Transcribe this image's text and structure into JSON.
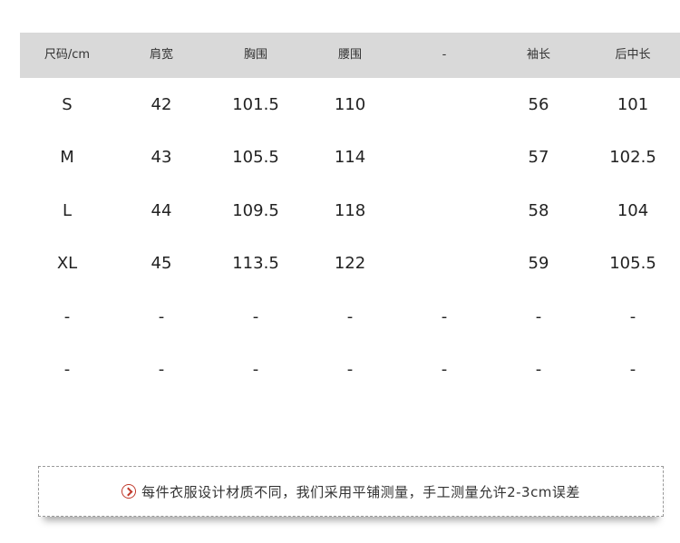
{
  "table": {
    "headers": [
      "尺码/cm",
      "肩宽",
      "胸围",
      "腰围",
      "-",
      "袖长",
      "后中长"
    ],
    "rows": [
      [
        "S",
        "42",
        "101.5",
        "110",
        "",
        "56",
        "101"
      ],
      [
        "M",
        "43",
        "105.5",
        "114",
        "",
        "57",
        "102.5"
      ],
      [
        "L",
        "44",
        "109.5",
        "118",
        "",
        "58",
        "104"
      ],
      [
        "XL",
        "45",
        "113.5",
        "122",
        "",
        "59",
        "105.5"
      ],
      [
        "-",
        "-",
        "-",
        "-",
        "-",
        "-",
        "-"
      ],
      [
        "-",
        "-",
        "-",
        "-",
        "-",
        "-",
        "-"
      ]
    ]
  },
  "note": {
    "icon": "chevron-right-circle-icon",
    "accent_color": "#c0392b",
    "text": "每件衣服设计材质不同，我们采用平铺测量，手工测量允许2-3cm误差"
  }
}
